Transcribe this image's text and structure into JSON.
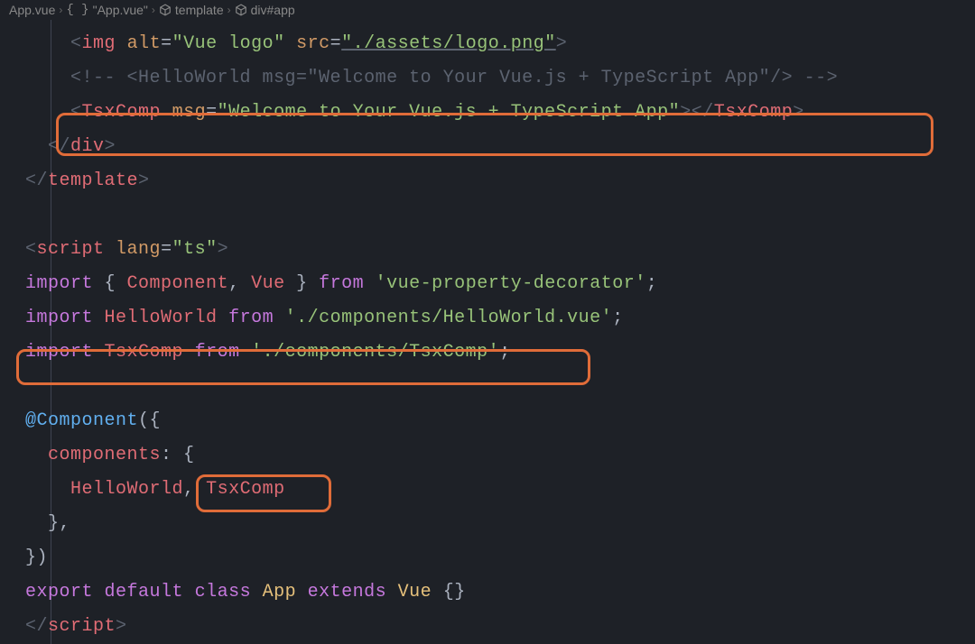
{
  "breadcrumb": {
    "file": "App.vue",
    "section": "\"App.vue\"",
    "template": "template",
    "element": "div#app"
  },
  "code": {
    "l1": {
      "indent": "    ",
      "open": "<",
      "tag": "img",
      "sp1": " ",
      "attr1": "alt",
      "eq1": "=",
      "val1": "\"Vue logo\"",
      "sp2": " ",
      "attr2": "src",
      "eq2": "=",
      "val2": "\"./assets/logo.png\"",
      "close": ">"
    },
    "l2": {
      "indent": "    ",
      "text": "<!-- <HelloWorld msg=\"Welcome to Your Vue.js + TypeScript App\"/> -->"
    },
    "l3": {
      "indent": "    ",
      "open": "<",
      "tag1": "TsxComp",
      "sp": " ",
      "attr": "msg",
      "eq": "=",
      "val": "\"Welcome to Your Vue.js + TypeScript App\"",
      "mid": "></",
      "tag2": "TsxComp",
      "close": ">"
    },
    "l4": {
      "indent": "  ",
      "open": "</",
      "tag": "div",
      "close": ">"
    },
    "l5": {
      "open": "</",
      "tag": "template",
      "close": ">"
    },
    "l7": {
      "open": "<",
      "tag": "script",
      "sp": " ",
      "attr": "lang",
      "eq": "=",
      "val": "\"ts\"",
      "close": ">"
    },
    "l8": {
      "kw": "import",
      "sp1": " ",
      "lb": "{ ",
      "n1": "Component",
      "c1": ", ",
      "n2": "Vue",
      "rb": " }",
      "sp2": " ",
      "from": "from",
      "sp3": " ",
      "path": "'vue-property-decorator'",
      "semi": ";"
    },
    "l9": {
      "kw": "import",
      "sp1": " ",
      "name": "HelloWorld",
      "sp2": " ",
      "from": "from",
      "sp3": " ",
      "path": "'./components/HelloWorld.vue'",
      "semi": ";"
    },
    "l10": {
      "kw": "import",
      "sp1": " ",
      "name": "TsxComp",
      "sp2": " ",
      "from": "from",
      "sp3": " ",
      "path": "'./components/TsxComp'",
      "semi": ";"
    },
    "l12": {
      "at": "@",
      "dec": "Component",
      "paren": "({"
    },
    "l13": {
      "indent": "  ",
      "key": "components",
      "colon": ": {"
    },
    "l14": {
      "indent": "    ",
      "n1": "HelloWorld",
      "c1": ", ",
      "n2": "TsxComp"
    },
    "l15": {
      "indent": "  ",
      "close": "},"
    },
    "l16": {
      "close": "})"
    },
    "l17": {
      "kw1": "export",
      "sp1": " ",
      "kw2": "default",
      "sp2": " ",
      "kw3": "class",
      "sp3": " ",
      "name": "App",
      "sp4": " ",
      "kw4": "extends",
      "sp5": " ",
      "base": "Vue",
      "sp6": " ",
      "braces": "{}"
    },
    "l18": {
      "open": "</",
      "tag": "script",
      "close": ">"
    }
  }
}
